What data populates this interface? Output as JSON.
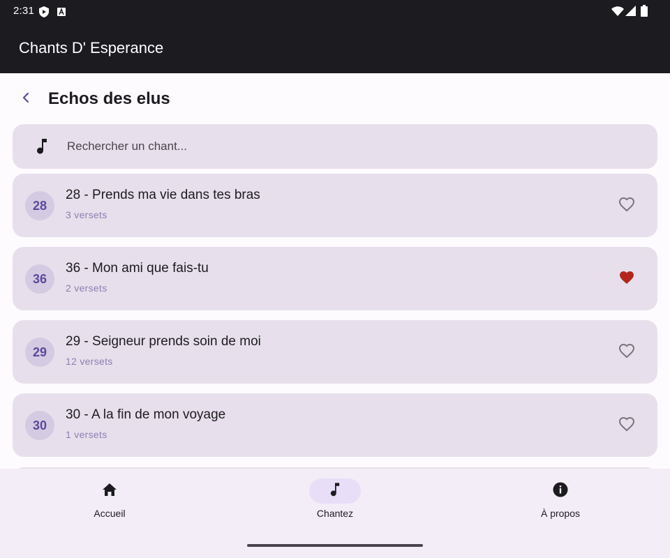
{
  "status_bar": {
    "time": "2:31",
    "left_icons": [
      "shield-icon",
      "a-badge-icon"
    ],
    "right_icons": [
      "wifi-icon",
      "signal-icon",
      "battery-icon"
    ]
  },
  "app_bar": {
    "title": "Chants D' Esperance"
  },
  "header": {
    "back_icon": "chevron-left-icon",
    "title": "Echos des elus"
  },
  "search": {
    "icon": "music-note-icon",
    "placeholder": "Rechercher un chant..."
  },
  "songs": [
    {
      "number": "28",
      "title": "28 - Prends ma vie dans tes bras",
      "verses": "3 versets",
      "favorite": false
    },
    {
      "number": "36",
      "title": "36 - Mon ami que fais-tu",
      "verses": "2 versets",
      "favorite": true
    },
    {
      "number": "29",
      "title": "29 - Seigneur prends soin de moi",
      "verses": "12 versets",
      "favorite": false
    },
    {
      "number": "30",
      "title": "30 - A la fin de mon voyage",
      "verses": "1 versets",
      "favorite": false
    }
  ],
  "bottom_nav": {
    "items": [
      {
        "label": "Accueil",
        "icon": "home-icon",
        "active": false
      },
      {
        "label": "Chantez",
        "icon": "music-note-icon",
        "active": true
      },
      {
        "label": "À propos",
        "icon": "info-icon",
        "active": false
      }
    ]
  },
  "colors": {
    "app_bar": "#1c1b1f",
    "card": "#e7e0ec",
    "accent": "#5b4a9a",
    "favorite": "#b3261e",
    "nav_active": "#e8def8"
  }
}
